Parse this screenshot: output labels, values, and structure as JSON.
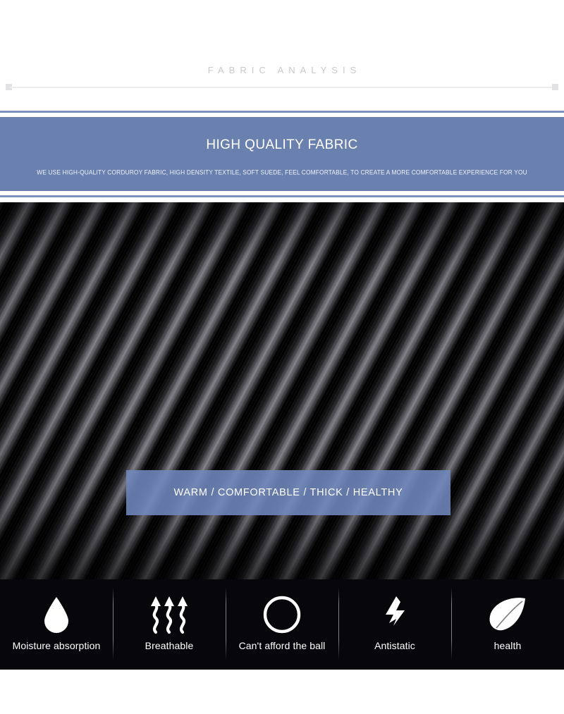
{
  "header": {
    "section_title": "FABRIC ANALYSIS"
  },
  "banner": {
    "heading": "HIGH QUALITY FABRIC",
    "subtitle": "WE USE HIGH-QUALITY CORDUROY FABRIC, HIGH DENSITY TEXTILE, SOFT SUEDE, FEEL COMFORTABLE, TO CREATE A MORE COMFORTABLE EXPERIENCE FOR YOU",
    "background_color": "#6a81b0",
    "rule_color": "#7a90bd"
  },
  "photo": {
    "caption": "WARM / COMFORTABLE / THICK / HEALTHY",
    "caption_background": "#7189bd",
    "alt": "close-up of black corduroy fabric with diagonal ridges"
  },
  "features": {
    "background_color": "#07070b",
    "items": [
      {
        "icon": "water-drop-icon",
        "label": "Moisture absorption"
      },
      {
        "icon": "airflow-arrows-icon",
        "label": "Breathable"
      },
      {
        "icon": "ring-circle-icon",
        "label": "Can't afford the ball"
      },
      {
        "icon": "lightning-bolt-icon",
        "label": "Antistatic"
      },
      {
        "icon": "leaf-icon",
        "label": "health"
      }
    ]
  }
}
